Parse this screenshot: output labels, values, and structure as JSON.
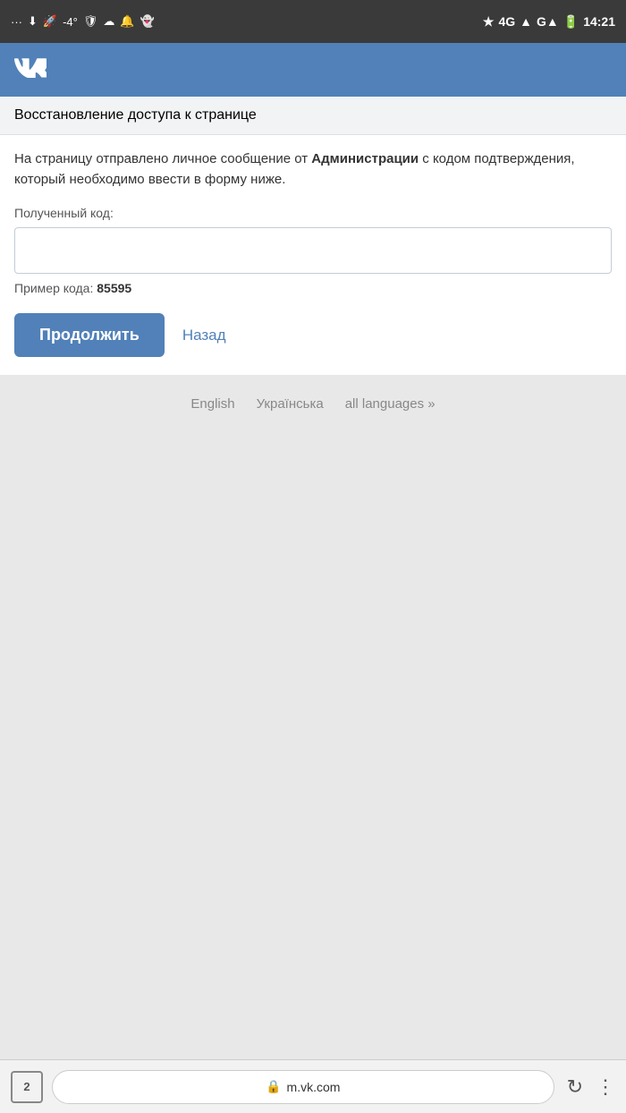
{
  "status_bar": {
    "time": "14:21",
    "temp": "-4°"
  },
  "header": {
    "logo": "ВК"
  },
  "page_title": "Восстановление доступа к странице",
  "description": {
    "part1": "На страницу отправлено личное сообщение от ",
    "bold": "Администрации",
    "part2": " с кодом подтверждения, который необходимо ввести в форму ниже."
  },
  "field": {
    "label": "Полученный код:",
    "placeholder": ""
  },
  "example": {
    "prefix": "Пример кода: ",
    "code": "85595"
  },
  "buttons": {
    "continue": "Продолжить",
    "back": "Назад"
  },
  "languages": {
    "english": "English",
    "ukrainian": "Українська",
    "all": "all languages »"
  },
  "browser": {
    "tab_count": "2",
    "url": "m.vk.com"
  }
}
